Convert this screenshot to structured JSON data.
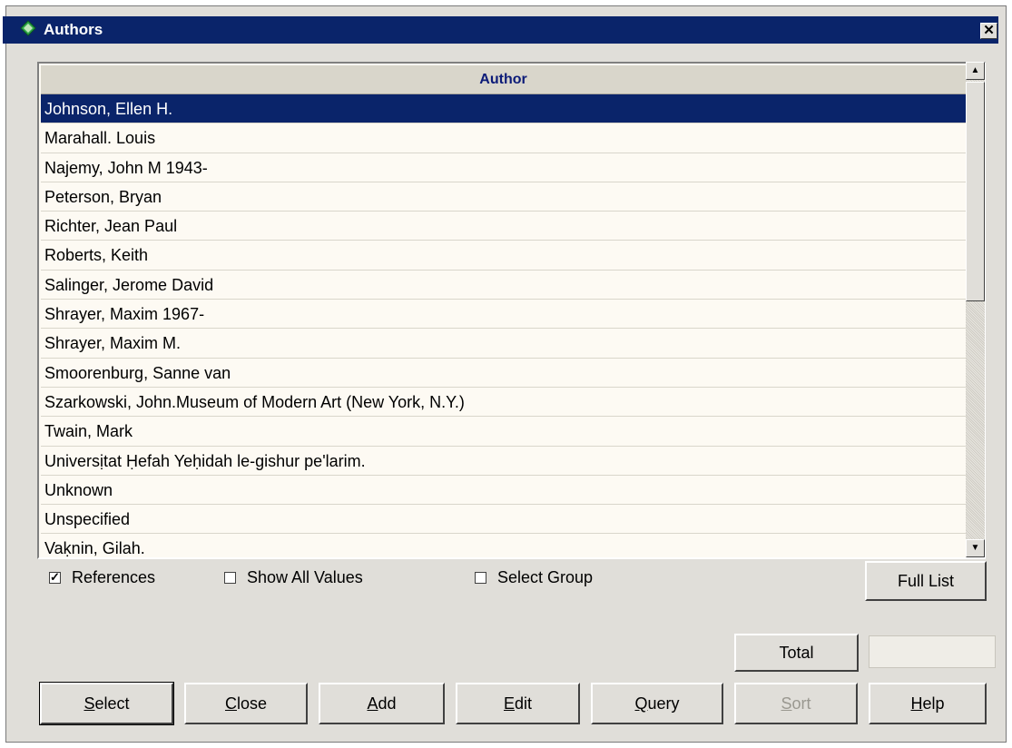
{
  "window": {
    "title": "Authors",
    "close_glyph": "✕"
  },
  "grid": {
    "column_header": "Author",
    "selected_index": 0,
    "rows": [
      "Johnson, Ellen H.",
      "Marahall. Louis",
      "Najemy, John M 1943-",
      "Peterson, Bryan",
      "Richter, Jean Paul",
      "Roberts, Keith",
      "Salinger, Jerome David",
      "Shrayer, Maxim 1967-",
      "Shrayer, Maxim M.",
      "Smoorenburg, Sanne van",
      "Szarkowski, John.Museum of Modern Art (New York, N.Y.)",
      "Twain, Mark",
      "Universịtat Ḥefah Yeḥidah le-gishur peʹlarim.",
      "Unknown",
      "Unspecified",
      "Vaḳnin, Gilah."
    ]
  },
  "options": {
    "references_label": "References",
    "references_checked": true,
    "show_all_label": "Show All Values",
    "show_all_checked": false,
    "select_group_label": "Select Group",
    "select_group_checked": false
  },
  "buttons": {
    "full_list": "Full List",
    "total": "Total",
    "select": "Select",
    "close": "Close",
    "add": "Add",
    "edit": "Edit",
    "query": "Query",
    "sort": "Sort",
    "help": "Help"
  },
  "total_value": "",
  "colors": {
    "title_bar": "#0a246a",
    "selection": "#0a246a",
    "header_text": "#0c1b78"
  }
}
